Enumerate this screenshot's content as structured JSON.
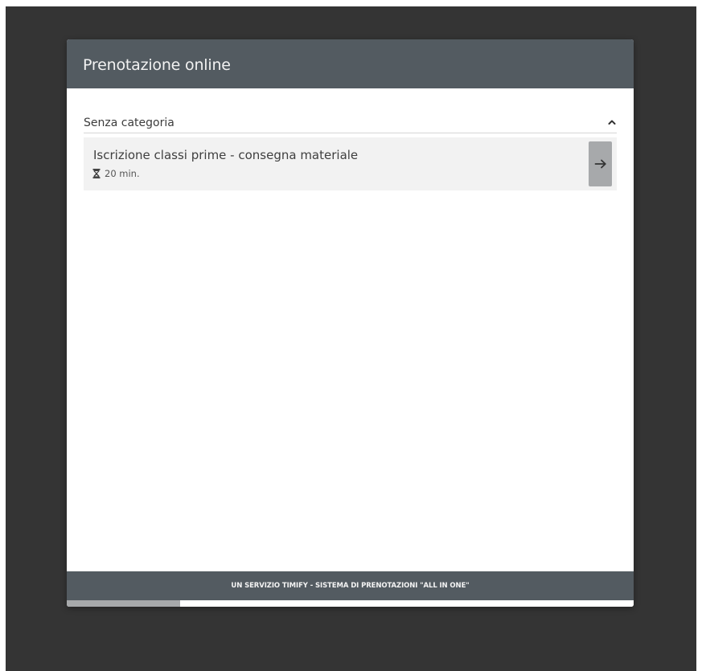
{
  "header": {
    "title": "Prenotazione online"
  },
  "category": {
    "label": "Senza categoria",
    "toggle_icon": "chevron-up-icon"
  },
  "services": [
    {
      "name": "Iscrizione classi prime - consegna materiale",
      "duration": "20 min.",
      "duration_icon": "hourglass-icon",
      "action_icon": "arrow-right-icon"
    }
  ],
  "footer": {
    "text": "UN SERVIZIO TIMIFY - SISTEMA DI PRENOTAZIONI \"ALL IN ONE\""
  },
  "progress": {
    "fraction": 0.2
  },
  "colors": {
    "header_bg": "#535b61",
    "backdrop": "#343434",
    "item_bg": "#f2f2f2",
    "button_bg": "#a7a9ab"
  }
}
